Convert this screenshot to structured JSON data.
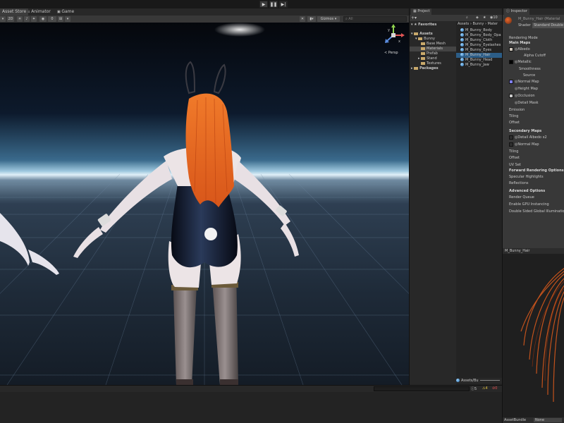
{
  "top_tabs": [
    "Asset Store",
    "Animator",
    "Game"
  ],
  "playback": {
    "play": "▶",
    "pause": "❚❚",
    "step": "▶|"
  },
  "scene_toolbar": {
    "mode_2d": "2D",
    "gizmos": "Gizmos",
    "search_placeholder": "All",
    "aa": "0"
  },
  "scene": {
    "orientation_label": "< Persp",
    "axis_y": "y",
    "axis_x": "x"
  },
  "project": {
    "tab": "Project",
    "count": "10",
    "favorites": "Favorites",
    "tree": [
      "Assets",
      "Bunny",
      "Base Mesh",
      "Materials",
      "Prefab",
      "Stand",
      "Textures",
      "Packages"
    ],
    "breadcrumb": [
      "Assets",
      "Bunny",
      "Mater"
    ],
    "files": [
      "M_Bunny_Body",
      "M_Bunny_Body_Opa",
      "M_Bunny_Cloth",
      "M_Bunny_Eyelashes",
      "M_Bunny_Eyes",
      "M_Bunny_Hair",
      "M_Bunny_Head",
      "M_Bunny_Jaw"
    ],
    "selected_file": "M_Bunny_Hair",
    "footer_path": "Assets/Bu"
  },
  "inspector": {
    "tab": "Inspector",
    "title": "M_Bunny_Hair (Material",
    "shader_label": "Shader",
    "shader_value": "Standard Double",
    "rows": [
      "Rendering Mode",
      "Main Maps",
      "Albedo",
      "Alpha Cutoff",
      "Metallic",
      "Smoothness",
      "Source",
      "Normal Map",
      "Height Map",
      "Occlusion",
      "Detail Mask",
      "Emission",
      "Tiling",
      "Offset",
      "Secondary Maps",
      "Detail Albedo x2",
      "Normal Map",
      "Tiling",
      "Offset",
      "UV Set",
      "Forward Rendering Options",
      "Specular Highlights",
      "Reflections",
      "Advanced Options",
      "Render Queue",
      "Enable GPU Instancing",
      "Double Sided Global Illumination"
    ],
    "preview_label": "M_Bunny_Hair",
    "assetbundle_label": "AssetBundle",
    "assetbundle_value": "None"
  },
  "console_counts": {
    "logs": "5",
    "warnings": "4",
    "errors": "0"
  },
  "colors": {
    "accent_selection": "#2c5d87",
    "hair": "#e8671c",
    "suit": "#0e1222"
  }
}
